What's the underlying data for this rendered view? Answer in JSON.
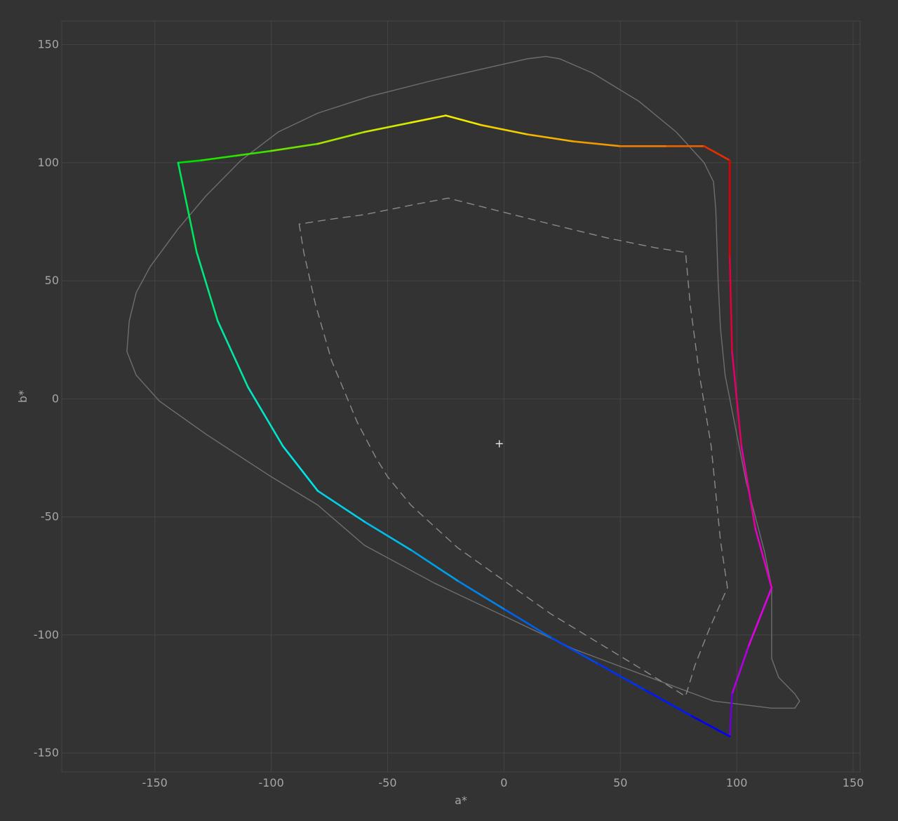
{
  "chart_data": {
    "type": "line",
    "title": "",
    "xlabel": "a*",
    "ylabel": "b*",
    "xlim": [
      -190,
      153
    ],
    "ylim": [
      -158,
      160
    ],
    "xticks": [
      -150,
      -100,
      -50,
      0,
      50,
      100,
      150
    ],
    "yticks": [
      -150,
      -100,
      -50,
      0,
      50,
      100,
      150
    ],
    "xtick_labels": [
      "-150",
      "-100",
      "-50",
      "0",
      "50",
      "100",
      "150"
    ],
    "ytick_labels": [
      "-150",
      "-100",
      "-50",
      "0",
      "50",
      "100",
      "150"
    ],
    "grid": true,
    "legend": "none",
    "colors": {
      "background": "#333333",
      "grid": "#454545",
      "text": "#a6a6a6",
      "reference_outline": "#6e6e6e",
      "inner_gamut": "#8a8a8a",
      "marker": "#e6e6e6"
    },
    "series": [
      {
        "style": "solid-gray-outline",
        "points": [
          [
            -162,
            20
          ],
          [
            -161,
            33
          ],
          [
            -158,
            45
          ],
          [
            -152,
            56
          ],
          [
            -140,
            72
          ],
          [
            -128,
            86
          ],
          [
            -113,
            101
          ],
          [
            -97,
            113
          ],
          [
            -80,
            121
          ],
          [
            -58,
            128
          ],
          [
            -30,
            135
          ],
          [
            -8,
            140
          ],
          [
            10,
            144
          ],
          [
            18,
            145
          ],
          [
            24,
            144
          ],
          [
            38,
            138
          ],
          [
            58,
            126
          ],
          [
            74,
            113
          ],
          [
            86,
            100
          ],
          [
            90,
            92
          ],
          [
            91,
            80
          ],
          [
            92,
            50
          ],
          [
            93,
            30
          ],
          [
            95,
            10
          ],
          [
            100,
            -15
          ],
          [
            104,
            -35
          ],
          [
            108,
            -50
          ],
          [
            112,
            -65
          ],
          [
            115,
            -80
          ],
          [
            115,
            -110
          ],
          [
            118,
            -118
          ],
          [
            125,
            -125
          ],
          [
            127,
            -128
          ],
          [
            125,
            -131
          ],
          [
            115,
            -131
          ],
          [
            90,
            -128
          ],
          [
            60,
            -117
          ],
          [
            30,
            -106
          ],
          [
            0,
            -92
          ],
          [
            -30,
            -78
          ],
          [
            -60,
            -62
          ],
          [
            -80,
            -45
          ],
          [
            -100,
            -33
          ],
          [
            -128,
            -15
          ],
          [
            -148,
            -1
          ],
          [
            -158,
            10
          ],
          [
            -162,
            20
          ]
        ]
      },
      {
        "style": "dashed-gray",
        "points": [
          [
            -88,
            74
          ],
          [
            -86,
            62
          ],
          [
            -81,
            40
          ],
          [
            -74,
            16
          ],
          [
            -63,
            -10
          ],
          [
            -55,
            -25
          ],
          [
            -50,
            -33
          ],
          [
            -40,
            -45
          ],
          [
            -20,
            -63
          ],
          [
            0,
            -77
          ],
          [
            20,
            -91
          ],
          [
            40,
            -103
          ],
          [
            60,
            -115
          ],
          [
            78,
            -126
          ],
          [
            82,
            -113
          ],
          [
            88,
            -98
          ],
          [
            96,
            -80
          ],
          [
            93,
            -60
          ],
          [
            89,
            -20
          ],
          [
            84,
            10
          ],
          [
            80,
            40
          ],
          [
            78,
            62
          ],
          [
            65,
            64
          ],
          [
            45,
            68
          ],
          [
            20,
            74
          ],
          [
            0,
            79
          ],
          [
            -24,
            85
          ],
          [
            -40,
            82
          ],
          [
            -60,
            78
          ],
          [
            -75,
            76
          ],
          [
            -88,
            74
          ]
        ]
      },
      {
        "style": "rainbow-solid",
        "points": [
          [
            -140,
            100,
            "#00e000"
          ],
          [
            -130,
            101,
            "#1fe500"
          ],
          [
            -115,
            103,
            "#3ae000"
          ],
          [
            -100,
            105,
            "#70e000"
          ],
          [
            -80,
            108,
            "#a8e400"
          ],
          [
            -60,
            113,
            "#d2e800"
          ],
          [
            -40,
            117,
            "#eeea00"
          ],
          [
            -25,
            120,
            "#f2ea00"
          ],
          [
            -10,
            116,
            "#f2d000"
          ],
          [
            10,
            112,
            "#f2b400"
          ],
          [
            30,
            109,
            "#ef9a00"
          ],
          [
            50,
            107,
            "#ea7e00"
          ],
          [
            70,
            107,
            "#e86000"
          ],
          [
            86,
            107,
            "#e42f00"
          ],
          [
            97,
            101,
            "#e00000"
          ],
          [
            97,
            60,
            "#e0003a"
          ],
          [
            98,
            20,
            "#e00068"
          ],
          [
            102,
            -20,
            "#e2009c"
          ],
          [
            108,
            -55,
            "#e000c4"
          ],
          [
            115,
            -80,
            "#e000e6"
          ],
          [
            105,
            -105,
            "#b000e0"
          ],
          [
            98,
            -125,
            "#7000d8"
          ],
          [
            97,
            -143,
            "#0000ff"
          ],
          [
            80,
            -134,
            "#0018ff"
          ],
          [
            60,
            -123,
            "#0030f8"
          ],
          [
            40,
            -112,
            "#0046f0"
          ],
          [
            20,
            -101,
            "#0060e8"
          ],
          [
            0,
            -89,
            "#0082e8"
          ],
          [
            -20,
            -77,
            "#00a0e8"
          ],
          [
            -40,
            -64,
            "#00bce8"
          ],
          [
            -60,
            -52,
            "#00d0e8"
          ],
          [
            -80,
            -39,
            "#00e4e4"
          ],
          [
            -95,
            -20,
            "#00e6c6"
          ],
          [
            -110,
            5,
            "#00e6a6"
          ],
          [
            -123,
            33,
            "#00e680"
          ],
          [
            -132,
            62,
            "#00e45a"
          ],
          [
            -140,
            100,
            "#00e000"
          ]
        ]
      }
    ],
    "annotations": [
      {
        "type": "marker",
        "symbol": "+",
        "x": -2,
        "y": -19
      }
    ]
  }
}
